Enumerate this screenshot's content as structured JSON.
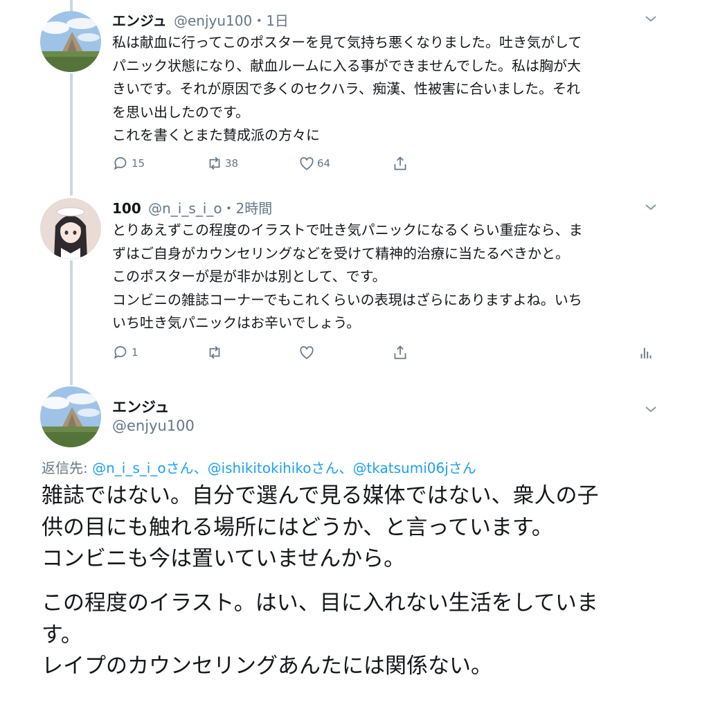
{
  "tweets": [
    {
      "name": "エンジュ",
      "meta": "@enjyu100・1日",
      "lines": [
        "私は献血に行ってこのポスターを見て気持ち悪くなりました。吐き気がして",
        "パニック状態になり、献血ルームに入る事ができませんでした。私は胸が大",
        "きいです。それが原因で多くのセクハラ、痴漢、性被害に合いました。それ",
        "を思い出したのです。",
        "これを書くとまた賛成派の方々に"
      ],
      "replies": "15",
      "retweets": "38",
      "likes": "64",
      "icons": [
        "reply-icon",
        "retweet-icon",
        "like-icon",
        "share-icon"
      ]
    },
    {
      "name": "100",
      "meta": "@n_i_s_i_o・2時間",
      "lines": [
        "とりあえずこの程度のイラストで吐き気パニックになるくらい重症なら、ま",
        "ずはご自身がカウンセリングなどを受けて精神的治療に当たるべきかと。",
        "このポスターが是が非かは別として、です。",
        "コンビニの雑誌コーナーでもこれくらいの表現はざらにありますよね。いち",
        "いち吐き気パニックはお辛いでしょう。"
      ],
      "replies": "1",
      "retweets": "",
      "likes": "",
      "icons": [
        "reply-icon",
        "retweet-icon",
        "like-icon",
        "share-icon",
        "analytics-icon"
      ]
    }
  ],
  "main_tweet": {
    "name": "エンジュ",
    "handle": "@enjyu100",
    "reply_prefix": "返信先: ",
    "reply_targets": [
      {
        "user": "@n_i_s_i_o",
        "suffix": "さん"
      },
      {
        "user": "@ishikitokihiko",
        "suffix": "さん"
      },
      {
        "user": "@tkatsumi06j",
        "suffix": "さん"
      }
    ],
    "separator": "、",
    "paragraph1": [
      "雑誌ではない。自分で選んで見る媒体ではない、衆人の子",
      "供の目にも触れる場所にはどうか、と言っています。",
      "コンビニも今は置いていませんから。"
    ],
    "paragraph2": [
      "この程度のイラスト。はい、目に入れない生活をしていま",
      "す。",
      "レイプのカウンセリングあんたには関係ない。"
    ]
  },
  "colors": {
    "text": "#14171a",
    "secondary": "#657786",
    "link": "#1da1f2",
    "thread_line": "#ccd6dd"
  }
}
